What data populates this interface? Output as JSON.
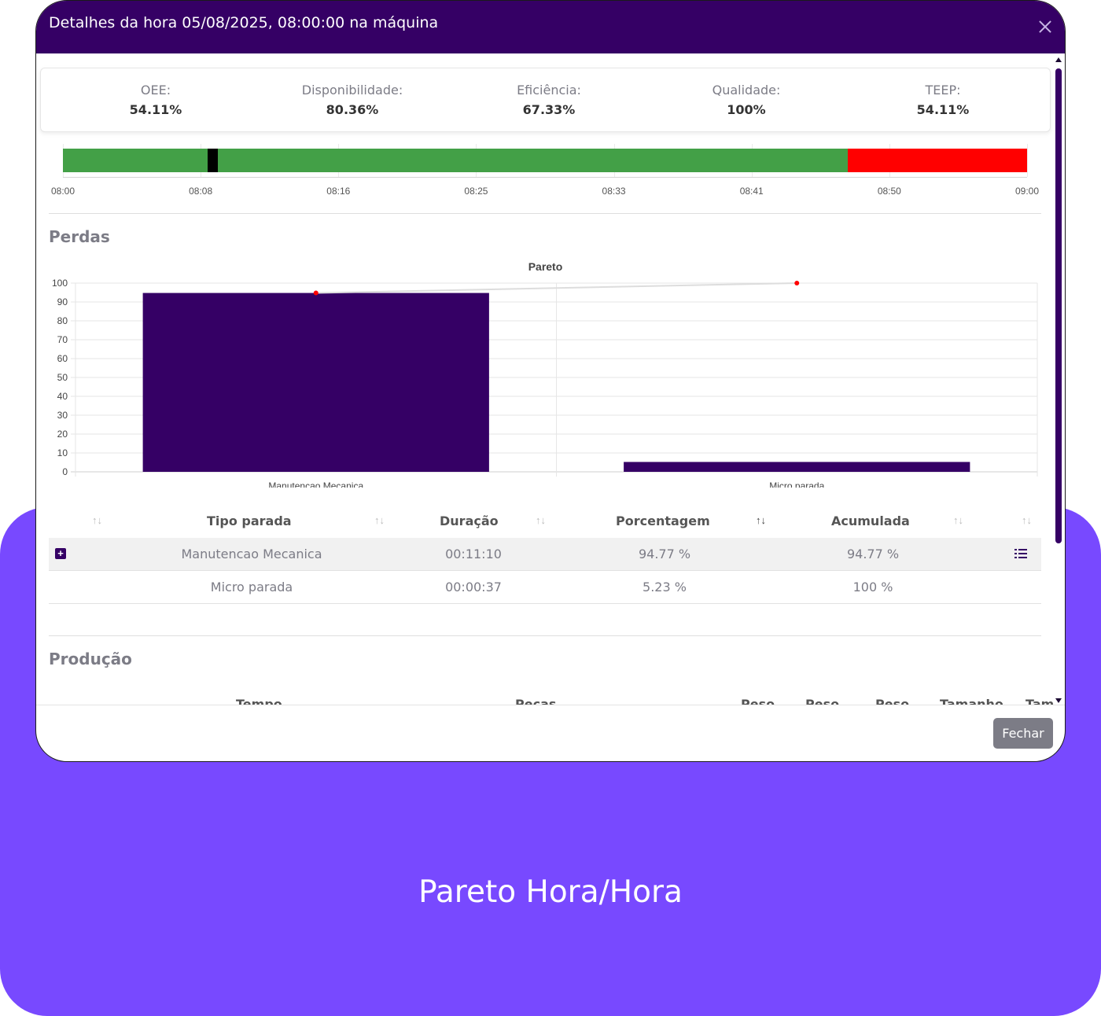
{
  "modal": {
    "title": "Detalhes da hora 05/08/2025, 08:00:00 na máquina",
    "close_label": "",
    "fechar_label": "Fechar"
  },
  "kpis": [
    {
      "label": "OEE:",
      "value": "54.11%"
    },
    {
      "label": "Disponibilidade:",
      "value": "80.36%"
    },
    {
      "label": "Eficiência:",
      "value": "67.33%"
    },
    {
      "label": "Qualidade:",
      "value": "100%"
    },
    {
      "label": "TEEP:",
      "value": "54.11%"
    }
  ],
  "timeline": {
    "labels": [
      "08:00",
      "08:08",
      "08:16",
      "08:25",
      "08:33",
      "08:41",
      "08:50",
      "09:00"
    ],
    "segments": [
      {
        "state": "running",
        "color": "#43a047",
        "start_frac": 0.0,
        "end_frac": 0.15
      },
      {
        "state": "stop",
        "color": "#000000",
        "start_frac": 0.15,
        "end_frac": 0.161
      },
      {
        "state": "running",
        "color": "#43a047",
        "start_frac": 0.161,
        "end_frac": 0.814
      },
      {
        "state": "down",
        "color": "#ff0000",
        "start_frac": 0.814,
        "end_frac": 1.0
      }
    ]
  },
  "losses": {
    "section_title": "Perdas",
    "table": {
      "headers": [
        "Tipo parada",
        "Duração",
        "Porcentagem",
        "Acumulada"
      ],
      "rows": [
        {
          "tipo": "Manutencao Mecanica",
          "duracao": "00:11:10",
          "porcentagem": "94.77 %",
          "acumulada": "94.77 %"
        },
        {
          "tipo": "Micro parada",
          "duracao": "00:00:37",
          "porcentagem": "5.23 %",
          "acumulada": "100 %"
        }
      ]
    }
  },
  "production": {
    "section_title": "Produção",
    "headers": [
      "Tempo",
      "Pecas",
      "Peso",
      "Peso",
      "Peso",
      "Tamanho",
      "Tam"
    ]
  },
  "caption": "Pareto Hora/Hora",
  "colors": {
    "header": "#350065",
    "bar": "#350065",
    "line": "#dddddd",
    "point": "#ff0000",
    "background": "#7849ff"
  },
  "chart_data": {
    "type": "bar",
    "title": "Pareto",
    "categories": [
      "Manutencao Mecanica",
      "Micro parada"
    ],
    "series": [
      {
        "values": [
          94.77,
          5.23
        ],
        "kind": "bar"
      },
      {
        "values": [
          94.77,
          100
        ],
        "kind": "line"
      }
    ],
    "ylim": [
      0,
      100
    ],
    "yticks": [
      0,
      10,
      20,
      30,
      40,
      50,
      60,
      70,
      80,
      90,
      100
    ],
    "grid": true
  }
}
